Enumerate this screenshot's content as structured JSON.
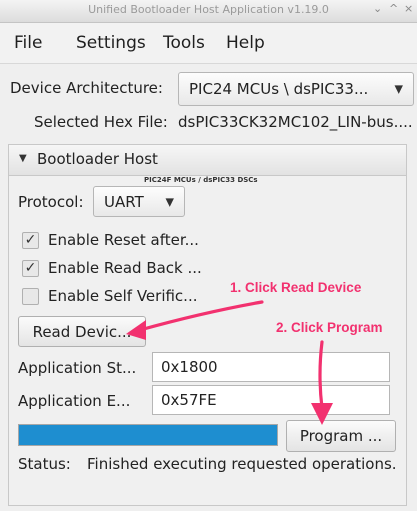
{
  "window": {
    "title": "Unified Bootloader Host Application v1.19.0",
    "controls": [
      "⌄",
      "^",
      "×"
    ]
  },
  "menu": {
    "items": [
      "File",
      "Settings",
      "Tools",
      "Help"
    ]
  },
  "device": {
    "architecture_label": "Device Architecture:",
    "architecture_value": "PIC24 MCUs \\ dsPIC33...",
    "hex_label": "Selected Hex File:",
    "hex_value": "dsPIC33CK32MC102_LIN-bus...."
  },
  "bootloader": {
    "header": "Bootloader Host",
    "subtitle": "PIC24F MCUs / dsPIC33 DSCs",
    "protocol_label": "Protocol:",
    "protocol_value": "UART",
    "options": [
      {
        "label": "Enable Reset after...",
        "checked": true
      },
      {
        "label": "Enable Read Back ...",
        "checked": true
      },
      {
        "label": "Enable Self Verific...",
        "checked": false
      }
    ],
    "read_button": "Read Devic...",
    "app_start_label": "Application St...",
    "app_start_value": "0x1800",
    "app_end_label": "Application E...",
    "app_end_value": "0x57FE",
    "program_button": "Program ...",
    "progress_fraction": 1.0,
    "status_label": "Status:",
    "status_text": "Finished executing requested operations."
  },
  "annotations": {
    "read": "1. Click Read Device",
    "program": "2. Click Program",
    "color": "#f2316f"
  }
}
